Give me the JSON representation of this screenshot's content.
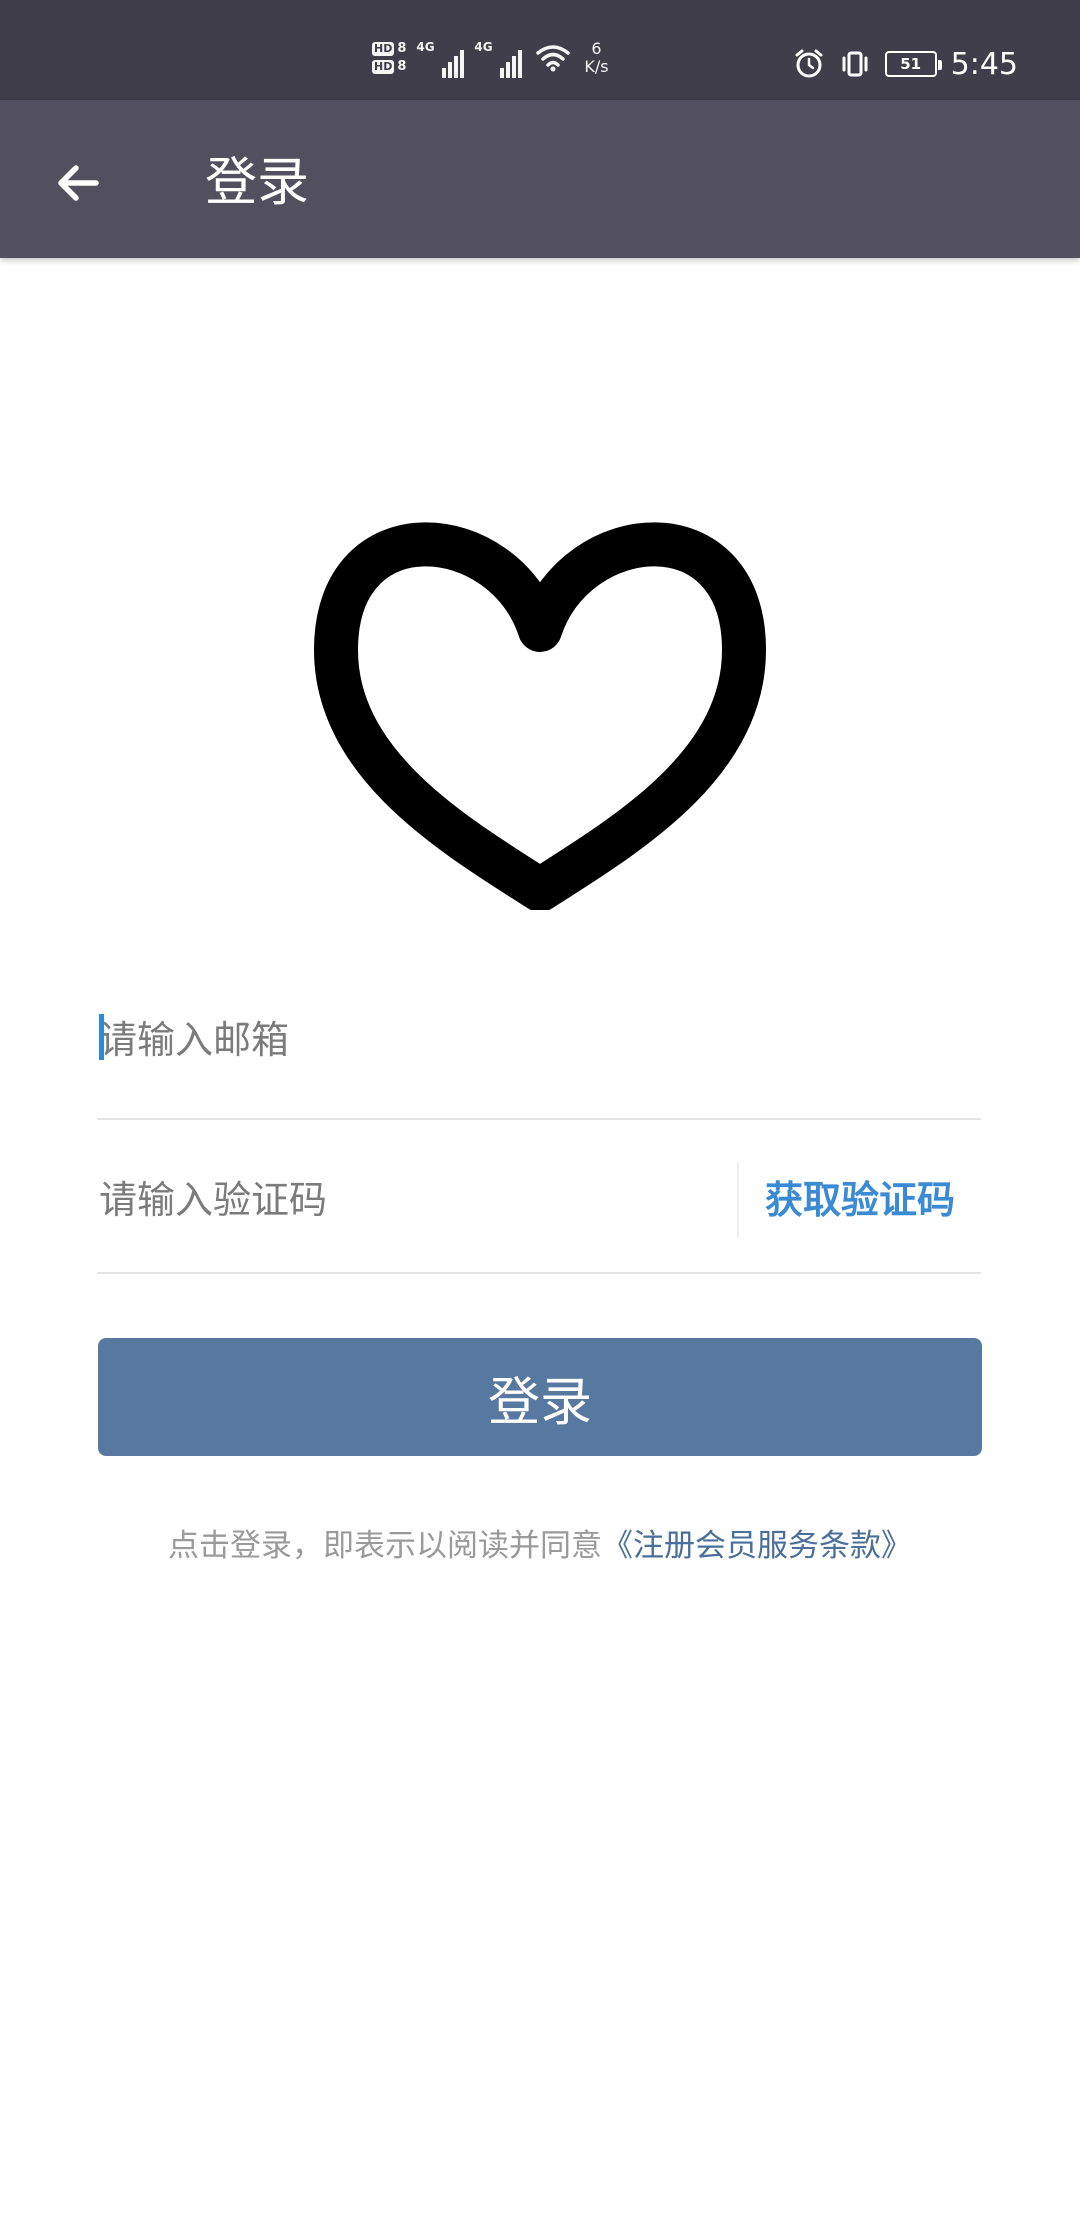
{
  "status_bar": {
    "hd_label": "HD",
    "hd_sim1": "8",
    "hd_sim2": "8",
    "signal_tag": "4G",
    "net_speed_value": "6",
    "net_speed_unit": "K/s",
    "battery_level": "51",
    "time": "5:45",
    "icons": [
      "hd-icon",
      "signal-4g-icon",
      "signal-4g-icon",
      "wifi-icon",
      "alarm-icon",
      "vibrate-icon",
      "battery-icon"
    ]
  },
  "app_bar": {
    "title": "登录",
    "back_icon": "arrow-left-icon"
  },
  "logo": {
    "icon": "heart-outline-icon"
  },
  "form": {
    "email_placeholder": "请输入邮箱",
    "code_placeholder": "请输入验证码",
    "get_code_label": "获取验证码",
    "login_label": "登录"
  },
  "agreement": {
    "prefix": "点击登录，即表示以阅读并同意",
    "link": "《注册会员服务条款》"
  },
  "colors": {
    "status_bar_bg": "#3f3e4a",
    "app_bar_bg": "#52505f",
    "login_button_bg": "#5779a0",
    "link_blue": "#3a8bd3",
    "terms_link": "#4a6f9a",
    "caret": "#2f89d8"
  }
}
